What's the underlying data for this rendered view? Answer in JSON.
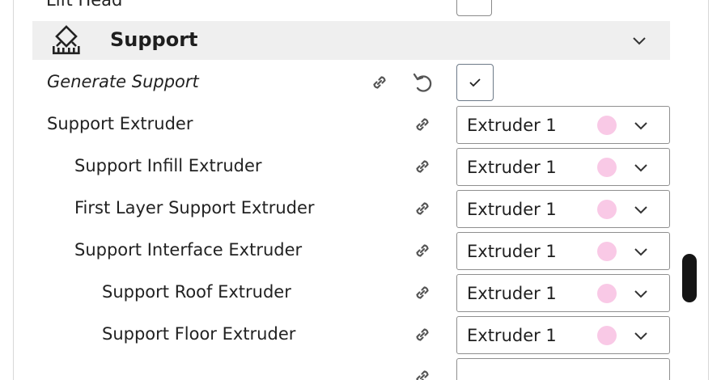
{
  "previous_setting": {
    "label": "Lift Head"
  },
  "section": {
    "title": "Support",
    "icon": "support-icon",
    "collapse_icon": "chevron-down-icon"
  },
  "settings": [
    {
      "label": "Generate Support",
      "type": "checkbox",
      "checked": true,
      "italic": true,
      "icons": [
        "link-icon",
        "reset-icon"
      ]
    },
    {
      "label": "Support Extruder",
      "type": "select",
      "value": "Extruder 1",
      "swatch_color": "#f9c9e6"
    },
    {
      "label": "Support Infill Extruder",
      "type": "select",
      "value": "Extruder 1",
      "swatch_color": "#f9c9e6"
    },
    {
      "label": "First Layer Support Extruder",
      "type": "select",
      "value": "Extruder 1",
      "swatch_color": "#f9c9e6"
    },
    {
      "label": "Support Interface Extruder",
      "type": "select",
      "value": "Extruder 1",
      "swatch_color": "#f9c9e6"
    },
    {
      "label": "Support Roof Extruder",
      "type": "select",
      "value": "Extruder 1",
      "swatch_color": "#f9c9e6"
    },
    {
      "label": "Support Floor Extruder",
      "type": "select",
      "value": "Extruder 1",
      "swatch_color": "#f9c9e6"
    }
  ],
  "colors": {
    "header_bg": "#efefef",
    "swatch": "#f9c9e6",
    "scrollbar": "#151515"
  }
}
